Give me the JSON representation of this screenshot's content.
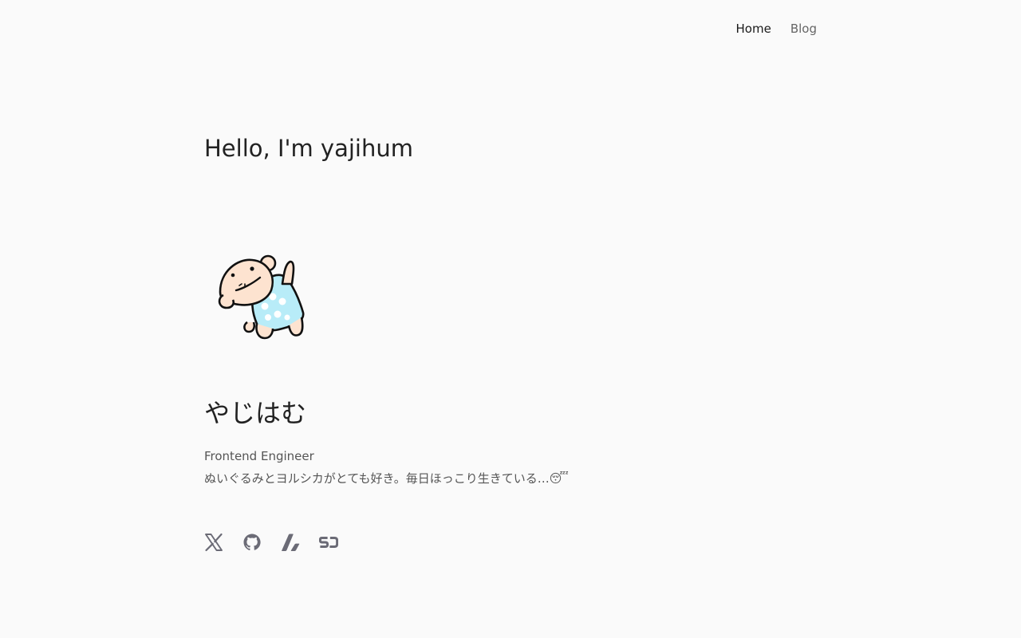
{
  "nav": {
    "items": [
      {
        "label": "Home",
        "active": true
      },
      {
        "label": "Blog",
        "active": false
      }
    ]
  },
  "hero": {
    "greeting": "Hello, I'm yajihum"
  },
  "profile": {
    "name": "やじはむ",
    "role": "Frontend Engineer",
    "bio": "ぬいぐるみとヨルシカがとても好き。毎日ほっこり生きている…😴",
    "avatar_icon": "hamster-plush-illustration"
  },
  "socials": [
    {
      "icon": "x-twitter-icon"
    },
    {
      "icon": "github-icon"
    },
    {
      "icon": "zenn-icon"
    },
    {
      "icon": "sizu-icon"
    }
  ],
  "colors": {
    "background": "#fafafa",
    "text": "#222222",
    "muted": "#555555",
    "icon": "#6b6b76",
    "avatar_skin": "#fde3d0",
    "avatar_clothes": "#b8ecf8"
  }
}
